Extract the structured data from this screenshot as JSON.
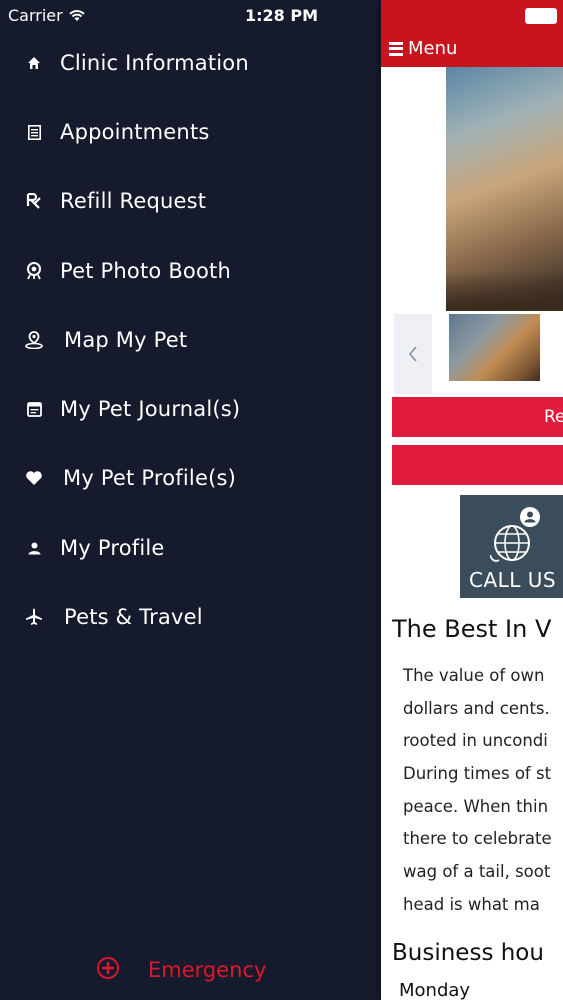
{
  "status_bar": {
    "carrier": "Carrier",
    "time": "1:28 PM"
  },
  "drawer": {
    "items": [
      {
        "label": "Clinic Information",
        "icon": "home-icon"
      },
      {
        "label": "Appointments",
        "icon": "calendar-list-icon"
      },
      {
        "label": "Refill Request",
        "icon": "rx-icon"
      },
      {
        "label": "Pet Photo Booth",
        "icon": "photo-booth-icon"
      },
      {
        "label": "Map My Pet",
        "icon": "map-pin-icon"
      },
      {
        "label": "My Pet Journal(s)",
        "icon": "journal-icon"
      },
      {
        "label": "My Pet Profile(s)",
        "icon": "heart-icon"
      },
      {
        "label": "My Profile",
        "icon": "user-icon"
      },
      {
        "label": "Pets & Travel",
        "icon": "airplane-icon"
      }
    ],
    "emergency": {
      "label": "Emergency",
      "icon": "plus-circle-icon",
      "color": "#e0162b"
    }
  },
  "main": {
    "menu_label": "Menu",
    "buttons": [
      "Re",
      ""
    ],
    "call_card_label": "CALL US",
    "title": "The Best In V",
    "paragraph_lines": [
      "The value of own",
      "dollars and cents.",
      "rooted in uncondi",
      "During times of st",
      "peace. When thin",
      "there to celebrate",
      "wag of a tail, soot",
      "head is what ma"
    ],
    "hours_title": "Business hou",
    "first_day": "Monday"
  },
  "colors": {
    "drawer_bg": "#151b2c",
    "brand_red": "#c8141f",
    "button_red": "#e21b3c",
    "card_bg": "#3b4c5a"
  }
}
